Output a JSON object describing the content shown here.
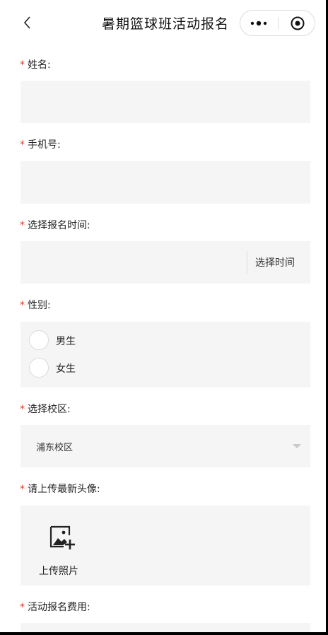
{
  "nav": {
    "title": "暑期篮球班活动报名",
    "back_icon": "chevron-left-icon",
    "more_icon": "more-dots-icon",
    "close_icon": "target-close-icon"
  },
  "form": {
    "required_mark": "*",
    "name": {
      "label": "姓名:",
      "value": ""
    },
    "phone": {
      "label": "手机号:",
      "value": ""
    },
    "time": {
      "label": "选择报名时间:",
      "button": "选择时间"
    },
    "gender": {
      "label": "性别:",
      "options": [
        "男生",
        "女生"
      ]
    },
    "campus": {
      "label": "选择校区:",
      "selected": "浦东校区"
    },
    "avatar": {
      "label": "请上传最新头像:",
      "button": "上传照片"
    },
    "fee": {
      "label": "活动报名费用:"
    }
  },
  "colors": {
    "required": "#e33b2e",
    "field_bg": "#f5f5f5",
    "text": "#222222"
  }
}
